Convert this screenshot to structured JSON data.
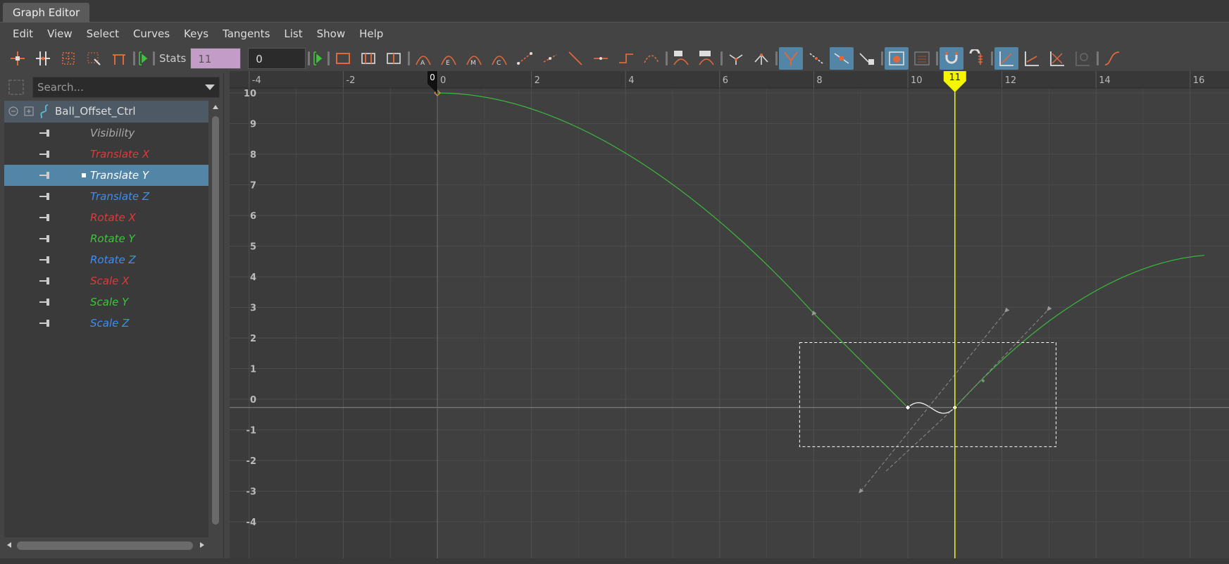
{
  "window": {
    "title": "Graph Editor"
  },
  "menu": [
    "Edit",
    "View",
    "Select",
    "Curves",
    "Keys",
    "Tangents",
    "List",
    "Show",
    "Help"
  ],
  "toolbar": {
    "stats_label": "Stats",
    "stats_frame": "11",
    "stats_value": "0"
  },
  "outliner": {
    "search_placeholder": "Search...",
    "root": "Ball_Offset_Ctrl",
    "channels": [
      {
        "label": "Visibility",
        "color": "#aaaaaa",
        "selected": false
      },
      {
        "label": "Translate X",
        "color": "#e0393b",
        "selected": false
      },
      {
        "label": "Translate Y",
        "color": "#ffffff",
        "selected": true
      },
      {
        "label": "Translate Z",
        "color": "#3d8df5",
        "selected": false
      },
      {
        "label": "Rotate X",
        "color": "#e0393b",
        "selected": false
      },
      {
        "label": "Rotate Y",
        "color": "#3dc43d",
        "selected": false
      },
      {
        "label": "Rotate Z",
        "color": "#3d8df5",
        "selected": false
      },
      {
        "label": "Scale X",
        "color": "#e0393b",
        "selected": false
      },
      {
        "label": "Scale Y",
        "color": "#3dc43d",
        "selected": false
      },
      {
        "label": "Scale Z",
        "color": "#3d8df5",
        "selected": false
      }
    ]
  },
  "graph": {
    "x_ticks": [
      "-4",
      "-2",
      "0",
      "2",
      "4",
      "6",
      "8",
      "10",
      "12",
      "14",
      "16"
    ],
    "y_ticks": [
      "10",
      "9",
      "8",
      "7",
      "6",
      "5",
      "4",
      "3",
      "2",
      "1",
      "0",
      "-1",
      "-2",
      "-3",
      "-4"
    ],
    "start_frame": "0",
    "current_frame": "11",
    "colors": {
      "curve": "#3cb83c",
      "playhead": "#f5f500",
      "selected_key": "#ffffff",
      "first_key": "#f0a020"
    }
  }
}
